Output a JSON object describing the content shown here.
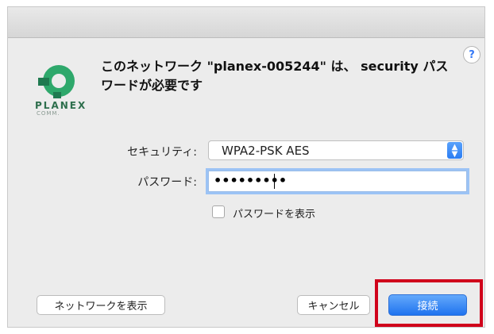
{
  "dialog": {
    "message": "このネットワーク \"planex-005244\" は、 security パスワードが必要です",
    "help_label": "?"
  },
  "logo": {
    "brand": "PLANEX",
    "sub": "COMM.",
    "colors": {
      "green": "#2ea86b",
      "dark_green": "#1f7a50"
    }
  },
  "form": {
    "security_label": "セキュリティ:",
    "security_value": "WPA2-PSK AES",
    "password_label": "パスワード:",
    "password_value": "•••••••••",
    "show_password_label": "パスワードを表示",
    "show_password_checked": false
  },
  "buttons": {
    "show_networks": "ネットワークを表示",
    "cancel": "キャンセル",
    "connect": "接続"
  },
  "colors": {
    "accent": "#2b7df3",
    "highlight": "#d0021b"
  }
}
